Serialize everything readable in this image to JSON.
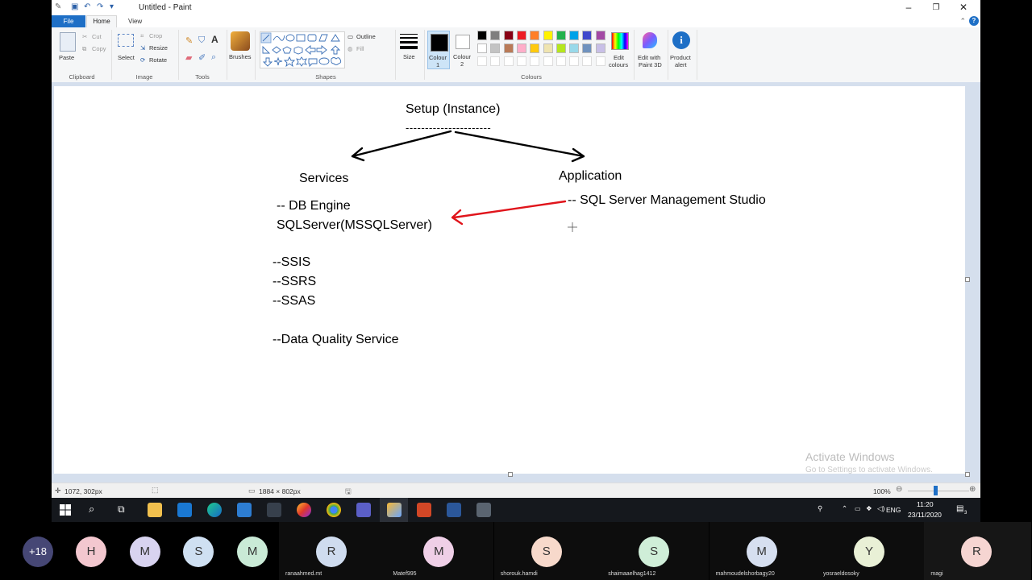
{
  "window": {
    "title": "Untitled - Paint"
  },
  "menu": {
    "file": "File",
    "home": "Home",
    "view": "View",
    "help": "?"
  },
  "ribbon": {
    "clipboard": {
      "paste": "Paste",
      "cut": "Cut",
      "copy": "Copy",
      "label": "Clipboard"
    },
    "image": {
      "select": "Select",
      "crop": "Crop",
      "resize": "Resize",
      "rotate": "Rotate",
      "label": "Image"
    },
    "tools": {
      "label": "Tools"
    },
    "brushes": {
      "label": "Brushes"
    },
    "shapes": {
      "outline": "Outline",
      "fill": "Fill",
      "label": "Shapes"
    },
    "size": {
      "label": "Size"
    },
    "colour1": {
      "line1": "Colour",
      "line2": "1"
    },
    "colour2": {
      "line1": "Colour",
      "line2": "2"
    },
    "colours": {
      "label": "Colours",
      "row1": [
        "#000000",
        "#7f7f7f",
        "#880015",
        "#ed1c24",
        "#ff7f27",
        "#fff200",
        "#22b14c",
        "#00a2e8",
        "#3f48cc",
        "#a349a4"
      ],
      "row2": [
        "#ffffff",
        "#c3c3c3",
        "#b97a57",
        "#ffaec9",
        "#ffc90e",
        "#efe4b0",
        "#b5e61d",
        "#99d9ea",
        "#7092be",
        "#c8bfe7"
      ]
    },
    "edit_colours": {
      "line1": "Edit",
      "line2": "colours"
    },
    "edit_paint3d": {
      "line1": "Edit with",
      "line2": "Paint 3D"
    },
    "product_alert": {
      "line1": "Product",
      "line2": "alert"
    }
  },
  "canvas": {
    "setup": "Setup (Instance)",
    "dashes": "----------------------",
    "services": "Services",
    "application": "Application",
    "db_engine": "--  DB Engine",
    "sqlserver": "SQLServer(MSSQLServer)",
    "ssms": "-- SQL Server Management Studio",
    "ssis": "--SSIS",
    "ssrs": "--SSRS",
    "ssas": "--SSAS",
    "dqs": "--Data Quality Service",
    "activate_title": "Activate Windows",
    "activate_sub": "Go to Settings to activate Windows."
  },
  "status": {
    "cursor": "1072, 302px",
    "dimensions": "1884 × 802px",
    "zoom": "100%"
  },
  "taskbar": {
    "lang": "ENG",
    "time": "11:20",
    "date": "23/11/2020",
    "notif_count": "3"
  },
  "participants": {
    "more": "+18",
    "tiles": [
      {
        "initial": "H",
        "color": "#f3c7cf",
        "name": ""
      },
      {
        "initial": "M",
        "color": "#d8d3f0",
        "name": ""
      },
      {
        "initial": "S",
        "color": "#cfe0f2",
        "name": ""
      },
      {
        "initial": "M",
        "color": "#c9ead6",
        "name": ""
      },
      {
        "initial": "R",
        "color": "#cfdcef",
        "name": "ranaahmed.mt"
      },
      {
        "initial": "M",
        "color": "#efcfe7",
        "name": "Matef995"
      },
      {
        "initial": "S",
        "color": "#f7d9cb",
        "name": "shorouk.hamdi"
      },
      {
        "initial": "S",
        "color": "#cfeed8",
        "name": "shaimaaelhag1412"
      },
      {
        "initial": "M",
        "color": "#d6dff0",
        "name": "mahmoudelshorbagy20"
      },
      {
        "initial": "Y",
        "color": "#e9f0d6",
        "name": "yosraeldosoky"
      },
      {
        "initial": "R",
        "color": "#f6d5d2",
        "name": "magi"
      }
    ]
  }
}
